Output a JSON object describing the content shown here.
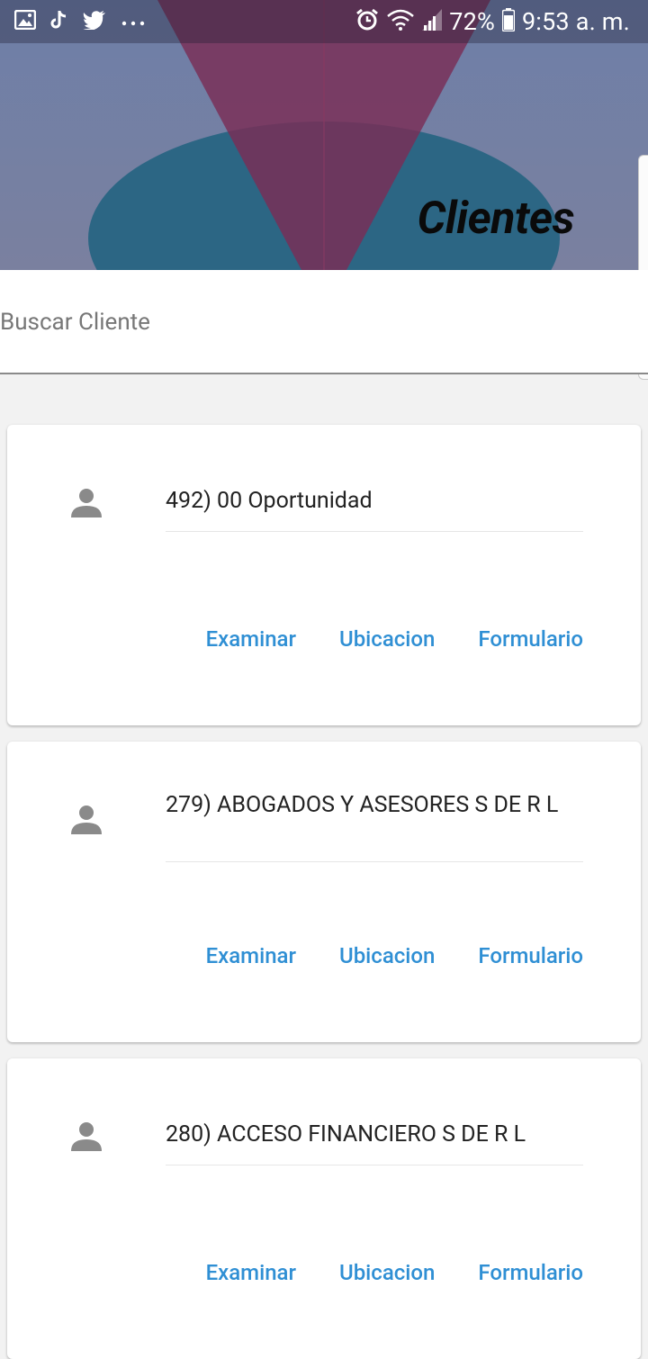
{
  "status_bar": {
    "battery": "72%",
    "time": "9:53 a. m.",
    "left_icons": [
      "gallery-icon",
      "tiktok-icon",
      "twitter-icon",
      "more-dots-icon"
    ],
    "right_icons": [
      "alarm-icon",
      "wifi-icon",
      "signal-icon",
      "battery-icon"
    ]
  },
  "header": {
    "title": "Clientes"
  },
  "search": {
    "placeholder": "Buscar Cliente"
  },
  "colors": {
    "action_blue": "#2f8fd4",
    "header_bg": "#6e7fa8",
    "icon_gray": "#8a8a8a"
  },
  "clients": [
    {
      "name": "492) 00 Oportunidad",
      "icon": "person-icon",
      "actions": {
        "examinar": "Examinar",
        "ubicacion": "Ubicacion",
        "formulario": "Formulario"
      }
    },
    {
      "name": "279) ABOGADOS Y ASESORES S DE R L",
      "icon": "person-icon",
      "actions": {
        "examinar": "Examinar",
        "ubicacion": "Ubicacion",
        "formulario": "Formulario"
      }
    },
    {
      "name": "280) ACCESO FINANCIERO S DE R L",
      "icon": "person-icon",
      "actions": {
        "examinar": "Examinar",
        "ubicacion": "Ubicacion",
        "formulario": "Formulario"
      }
    }
  ]
}
